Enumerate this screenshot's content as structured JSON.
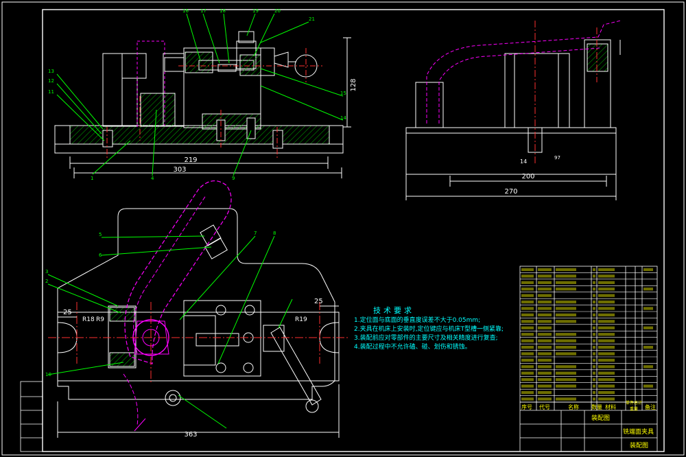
{
  "title_block": {
    "fixture_name": "铣端面夹具",
    "drawing_type": "装配图",
    "header_cols": [
      "序号",
      "代号",
      "名称",
      "数量",
      "材料",
      "单件",
      "总计",
      "重量",
      "备注"
    ]
  },
  "tech_requirements": {
    "title": "技术要求",
    "items": [
      "1.定位面与底面的垂直度误差不大于0.05mm;",
      "2.夹具在机床上安装时,定位键应与机床T型槽一侧紧靠;",
      "3.装配前应对零部件的主要尺寸及相关精度进行复查;",
      "4.装配过程中不允许磕、碰、划伤和锈蚀。"
    ]
  },
  "dimensions": {
    "front_view": [
      "219",
      "303",
      "128"
    ],
    "side_view": [
      "200",
      "270",
      "14",
      "97"
    ],
    "top_view": [
      "25",
      "25",
      "R18",
      "R9",
      "R19",
      "363"
    ]
  },
  "part_callouts": [
    "13",
    "12",
    "11",
    "1",
    "4",
    "9",
    "16",
    "17",
    "18",
    "19",
    "20",
    "21",
    "15",
    "14",
    "3",
    "2",
    "5",
    "6",
    "7",
    "8",
    "10"
  ],
  "colors": {
    "frame": "#ffffff",
    "outline": "#ffffff",
    "hatch": "#00ff00",
    "leader": "#00ff00",
    "centerline": "#ff3030",
    "phantom": "#ff00ff",
    "dimension": "#ffffff",
    "text": "#00ffff",
    "table_text": "#ffff00"
  }
}
